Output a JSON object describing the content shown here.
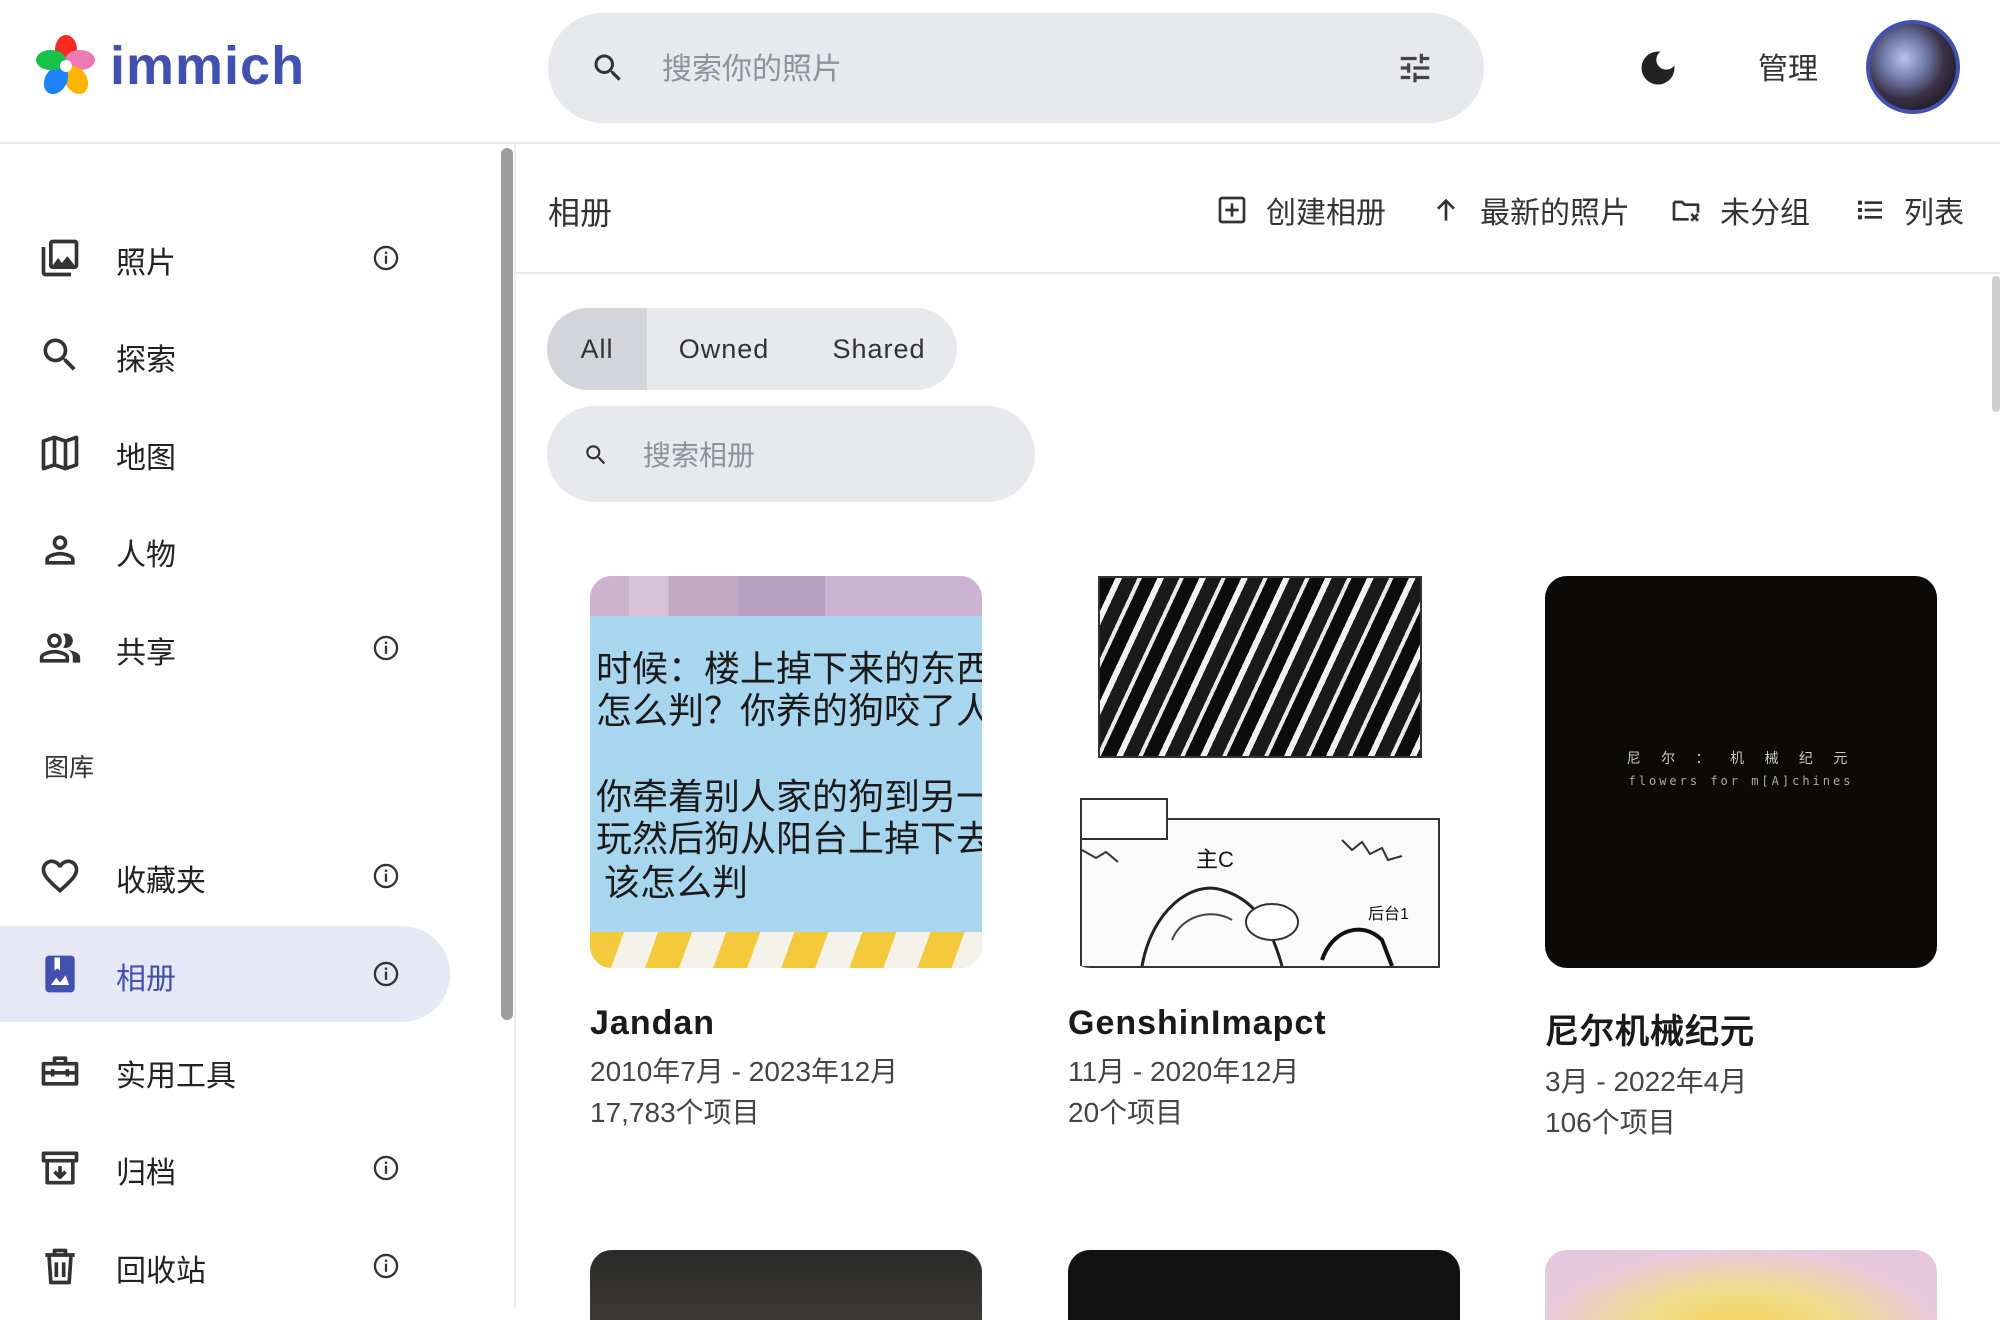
{
  "app": {
    "name": "immich"
  },
  "header": {
    "search_placeholder": "搜索你的照片",
    "admin_label": "管理"
  },
  "sidebar": {
    "items": [
      {
        "label": "照片",
        "icon": "photos-icon",
        "info": true
      },
      {
        "label": "探索",
        "icon": "search-icon",
        "info": false
      },
      {
        "label": "地图",
        "icon": "map-icon",
        "info": false
      },
      {
        "label": "人物",
        "icon": "person-icon",
        "info": false
      },
      {
        "label": "共享",
        "icon": "people-icon",
        "info": true
      }
    ],
    "library_title": "图库",
    "library_items": [
      {
        "label": "收藏夹",
        "icon": "heart-icon",
        "info": true
      },
      {
        "label": "相册",
        "icon": "album-icon",
        "info": true,
        "active": true
      },
      {
        "label": "实用工具",
        "icon": "toolbox-icon",
        "info": false
      },
      {
        "label": "归档",
        "icon": "archive-icon",
        "info": true
      },
      {
        "label": "回收站",
        "icon": "trash-icon",
        "info": true
      }
    ]
  },
  "toolbar": {
    "title": "相册",
    "create_album": "创建相册",
    "sort": "最新的照片",
    "group": "未分组",
    "view": "列表"
  },
  "filter": {
    "options": [
      "All",
      "Owned",
      "Shared"
    ],
    "selected": "All"
  },
  "album_search": {
    "placeholder": "搜索相册"
  },
  "albums": [
    {
      "title": "Jandan",
      "date_range": "2010年7月 - 2023年12月",
      "count": "17,783个项目",
      "thumb_text": [
        "时候：楼上掉下来的东西",
        "怎么判？你养的狗咬了人",
        "你牵着别人家的狗到另一",
        "玩然后狗从阳台上掉下去",
        "该怎么判"
      ]
    },
    {
      "title": "GenshinImapct",
      "date_range": "11月 - 2020年12月",
      "count": "20个项目",
      "thumb_text": [
        "主C",
        "后台1"
      ]
    },
    {
      "title": "尼尔机械纪元",
      "date_range": "3月 - 2022年4月",
      "count": "106个项目",
      "thumb_text": [
        "尼 尔 ： 机 械 纪 元",
        "flowers for m[A]chines"
      ]
    }
  ],
  "colors": {
    "brand": "#4251b0",
    "active_nav_bg": "#e6e8f5",
    "search_bg": "#e8e9ed"
  }
}
